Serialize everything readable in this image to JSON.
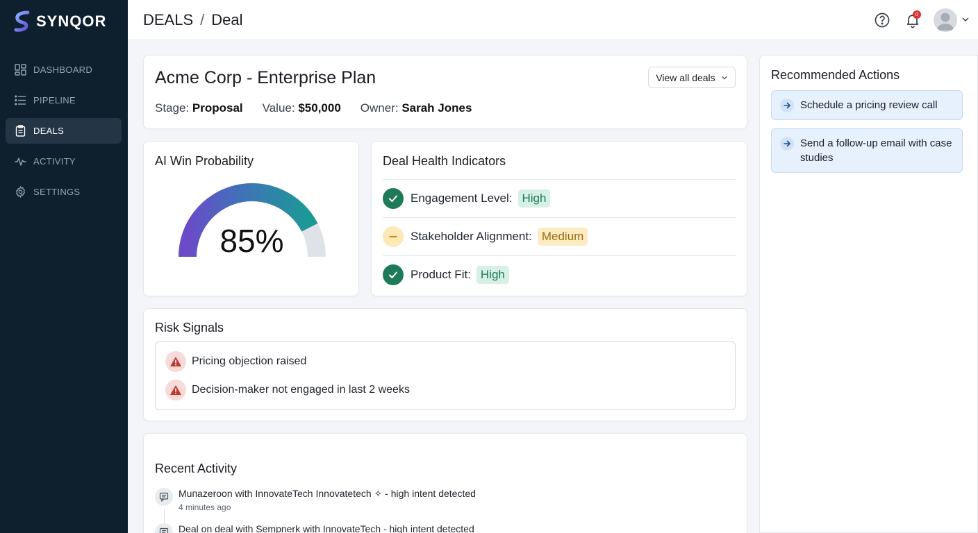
{
  "app": {
    "name": "SYNQOR"
  },
  "sidebar": {
    "items": [
      {
        "label": "DASHBOARD",
        "icon": "dashboard-icon",
        "active": false
      },
      {
        "label": "PIPELINE",
        "icon": "list-icon",
        "active": false
      },
      {
        "label": "DEALS",
        "icon": "clipboard-icon",
        "active": true
      },
      {
        "label": "ACTIVITY",
        "icon": "activity-icon",
        "active": false
      },
      {
        "label": "SETTINGS",
        "icon": "gear-icon",
        "active": false
      }
    ]
  },
  "header": {
    "breadcrumb": {
      "section": "DEALS",
      "separator": "/",
      "page": "Deal"
    },
    "notification_count": "0"
  },
  "deal": {
    "title": "Acme Corp - Enterprise Plan",
    "stage_label": "Stage:",
    "stage": "Proposal",
    "value_label": "Value:",
    "value": "$50,000",
    "owner_label": "Owner:",
    "owner": "Sarah Jones",
    "view_all_label": "View all deals"
  },
  "win_probability": {
    "title": "AI Win Probability",
    "value": 85,
    "display": "85%"
  },
  "health": {
    "title": "Deal Health Indicators",
    "items": [
      {
        "label": "Engagement Level:",
        "value": "High",
        "status": "ok"
      },
      {
        "label": "Stakeholder Alignment:",
        "value": "Medium",
        "status": "medium"
      },
      {
        "label": "Product Fit:",
        "value": "High",
        "status": "ok"
      }
    ]
  },
  "risk": {
    "title": "Risk Signals",
    "items": [
      "Pricing objection raised",
      "Decision-maker not engaged in last 2 weeks"
    ]
  },
  "activity": {
    "title": "Recent Activity",
    "items": [
      {
        "prefix": "Muпazeroon with",
        "company": "InnovateTech Innovatetech",
        "suffix": "✧ - high intent detected",
        "time": "4 minutes ago"
      },
      {
        "prefix": "Deal on deal with Sempnerk with",
        "company": "InnovateTech",
        "suffix": "- high intent detected",
        "time": ""
      }
    ]
  },
  "recommendations": {
    "title": "Recommended Actions",
    "items": [
      "Schedule a pricing review call",
      "Send a follow-up email with case studies"
    ]
  },
  "colors": {
    "sidebar_bg": "#0e1f2e",
    "accent_green": "#1f7a5a",
    "warning_yellow": "#fde9b8",
    "risk_red": "#c0392b",
    "gauge_start": "#6b4bc8",
    "gauge_end": "#1b9a95"
  }
}
